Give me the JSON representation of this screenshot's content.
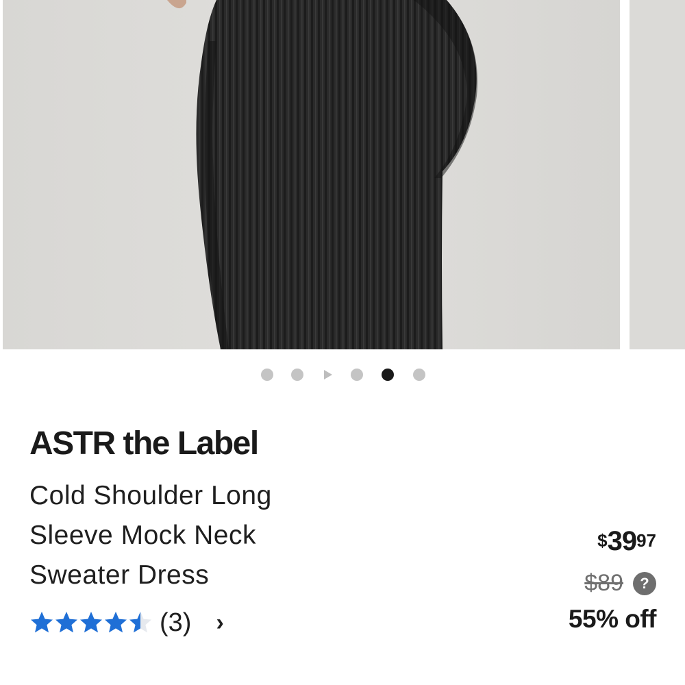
{
  "gallery": {
    "dot_count": 5,
    "active_dot": 4,
    "has_video_indicator": true
  },
  "product": {
    "brand": "ASTR the Label",
    "name": "Cold Shoulder Long Sleeve Mock Neck Sweater Dress",
    "rating": 4.5,
    "rating_max": 5,
    "review_count": "(3)",
    "chevron": "›",
    "star_color": "#1f6fd6"
  },
  "pricing": {
    "currency": "$",
    "whole": "39",
    "cents": "97",
    "original": "$89",
    "help_icon": "?",
    "discount": "55% off"
  }
}
